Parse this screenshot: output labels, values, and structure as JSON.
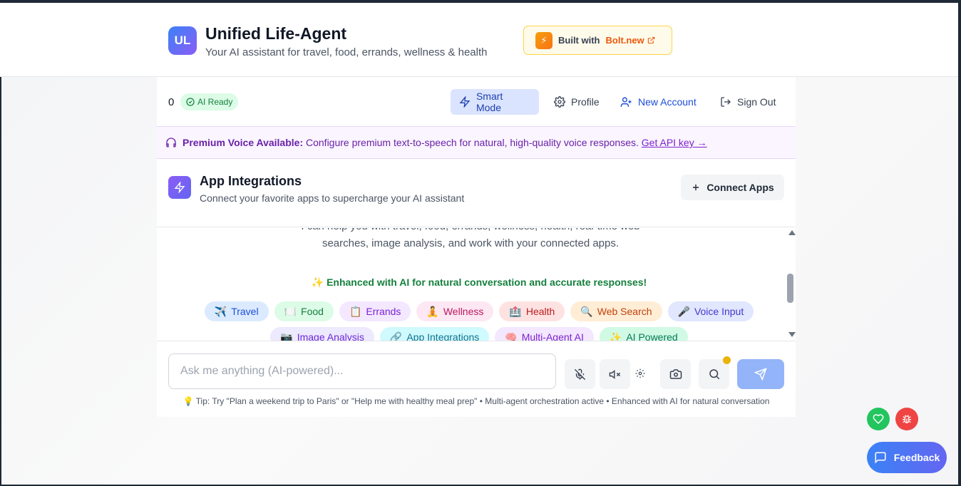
{
  "header": {
    "logo_text": "UL",
    "title": "Unified Life-Agent",
    "subtitle": "Your AI assistant for travel, food, errands, wellness & health",
    "built_with_label": "Built with",
    "built_with_link": "Bolt.new",
    "bolt_icon_glyph": "⚡"
  },
  "toolbar": {
    "counter": "0",
    "ai_ready": "AI Ready",
    "smart_mode": "Smart Mode",
    "profile": "Profile",
    "new_account": "New Account",
    "sign_out": "Sign Out"
  },
  "voice_banner": {
    "bold": "Premium Voice Available:",
    "text": "Configure premium text-to-speech for natural, high-quality voice responses.",
    "link": "Get API key →"
  },
  "integrations": {
    "title": "App Integrations",
    "subtitle": "Connect your favorite apps to supercharge your AI assistant",
    "connect_button": "Connect Apps"
  },
  "chat": {
    "intro": "I can help you with travel, food, errands, wellness, health, real-time web searches, image analysis, and work with your connected apps.",
    "enhanced": "✨ Enhanced with AI for natural conversation and accurate responses!",
    "chips_row1": [
      {
        "emoji": "✈️",
        "label": "Travel",
        "color": "blue"
      },
      {
        "emoji": "🍽️",
        "label": "Food",
        "color": "green"
      },
      {
        "emoji": "📋",
        "label": "Errands",
        "color": "purple"
      },
      {
        "emoji": "🧘",
        "label": "Wellness",
        "color": "pink"
      },
      {
        "emoji": "🏥",
        "label": "Health",
        "color": "red"
      },
      {
        "emoji": "🔍",
        "label": "Web Search",
        "color": "orange"
      },
      {
        "emoji": "🎤",
        "label": "Voice Input",
        "color": "indigo"
      }
    ],
    "chips_row2": [
      {
        "emoji": "📷",
        "label": "Image Analysis",
        "color": "violet"
      },
      {
        "emoji": "🔗",
        "label": "App Integrations",
        "color": "cyan"
      },
      {
        "emoji": "🧠",
        "label": "Multi-Agent AI",
        "color": "purple"
      },
      {
        "emoji": "✨",
        "label": "AI Powered",
        "color": "emerald"
      }
    ]
  },
  "composer": {
    "placeholder": "Ask me anything (AI-powered)...",
    "tip": "💡 Tip: Try \"Plan a weekend trip to Paris\" or \"Help me with healthy meal prep\" • Multi-agent orchestration active • Enhanced with AI for natural conversation"
  },
  "feedback": {
    "label": "Feedback"
  },
  "colors": {
    "accent": "#3b82f6",
    "brand_gradient_start": "#3b82f6",
    "brand_gradient_end": "#8b5cf6",
    "success": "#15803d",
    "premium": "#6b21a8"
  }
}
